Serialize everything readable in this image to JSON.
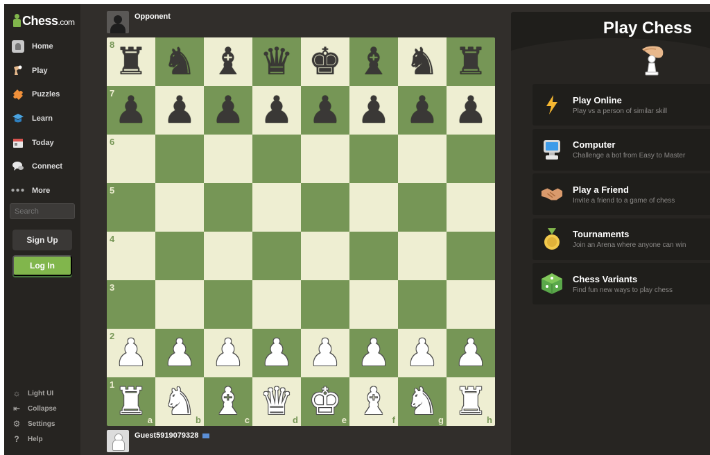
{
  "brand": {
    "name": "Chess",
    "suffix": ".com"
  },
  "sidebar": {
    "items": [
      {
        "label": "Home",
        "icon": "home-icon"
      },
      {
        "label": "Play",
        "icon": "play-icon"
      },
      {
        "label": "Puzzles",
        "icon": "puzzles-icon"
      },
      {
        "label": "Learn",
        "icon": "learn-icon"
      },
      {
        "label": "Today",
        "icon": "today-icon"
      },
      {
        "label": "Connect",
        "icon": "connect-icon"
      },
      {
        "label": "More",
        "icon": "more-icon"
      }
    ],
    "search_placeholder": "Search",
    "signup_label": "Sign Up",
    "login_label": "Log In",
    "bottom": [
      {
        "label": "Light UI",
        "icon": "sun-icon"
      },
      {
        "label": "Collapse",
        "icon": "collapse-icon"
      },
      {
        "label": "Settings",
        "icon": "gear-icon"
      },
      {
        "label": "Help",
        "icon": "help-icon"
      }
    ]
  },
  "players": {
    "top": {
      "name": "Opponent"
    },
    "bottom": {
      "name": "Guest5919079328"
    }
  },
  "board": {
    "ranks": [
      "8",
      "7",
      "6",
      "5",
      "4",
      "3",
      "2",
      "1"
    ],
    "files": [
      "a",
      "b",
      "c",
      "d",
      "e",
      "f",
      "g",
      "h"
    ],
    "position": [
      [
        "br",
        "bn",
        "bb",
        "bq",
        "bk",
        "bb",
        "bn",
        "br"
      ],
      [
        "bp",
        "bp",
        "bp",
        "bp",
        "bp",
        "bp",
        "bp",
        "bp"
      ],
      [
        "",
        "",
        "",
        "",
        "",
        "",
        "",
        ""
      ],
      [
        "",
        "",
        "",
        "",
        "",
        "",
        "",
        ""
      ],
      [
        "",
        "",
        "",
        "",
        "",
        "",
        "",
        ""
      ],
      [
        "",
        "",
        "",
        "",
        "",
        "",
        "",
        ""
      ],
      [
        "wp",
        "wp",
        "wp",
        "wp",
        "wp",
        "wp",
        "wp",
        "wp"
      ],
      [
        "wr",
        "wn",
        "wb",
        "wq",
        "wk",
        "wb",
        "wn",
        "wr"
      ]
    ],
    "colors": {
      "light": "#eeeed2",
      "dark": "#769656"
    }
  },
  "panel": {
    "title": "Play Chess",
    "options": [
      {
        "title": "Play Online",
        "subtitle": "Play vs a person of similar skill",
        "icon": "lightning-icon"
      },
      {
        "title": "Computer",
        "subtitle": "Challenge a bot from Easy to Master",
        "icon": "computer-icon"
      },
      {
        "title": "Play a Friend",
        "subtitle": "Invite a friend to a game of chess",
        "icon": "handshake-icon"
      },
      {
        "title": "Tournaments",
        "subtitle": "Join an Arena where anyone can win",
        "icon": "medal-icon"
      },
      {
        "title": "Chess Variants",
        "subtitle": "Find fun new ways to play chess",
        "icon": "dice-icon"
      }
    ]
  }
}
